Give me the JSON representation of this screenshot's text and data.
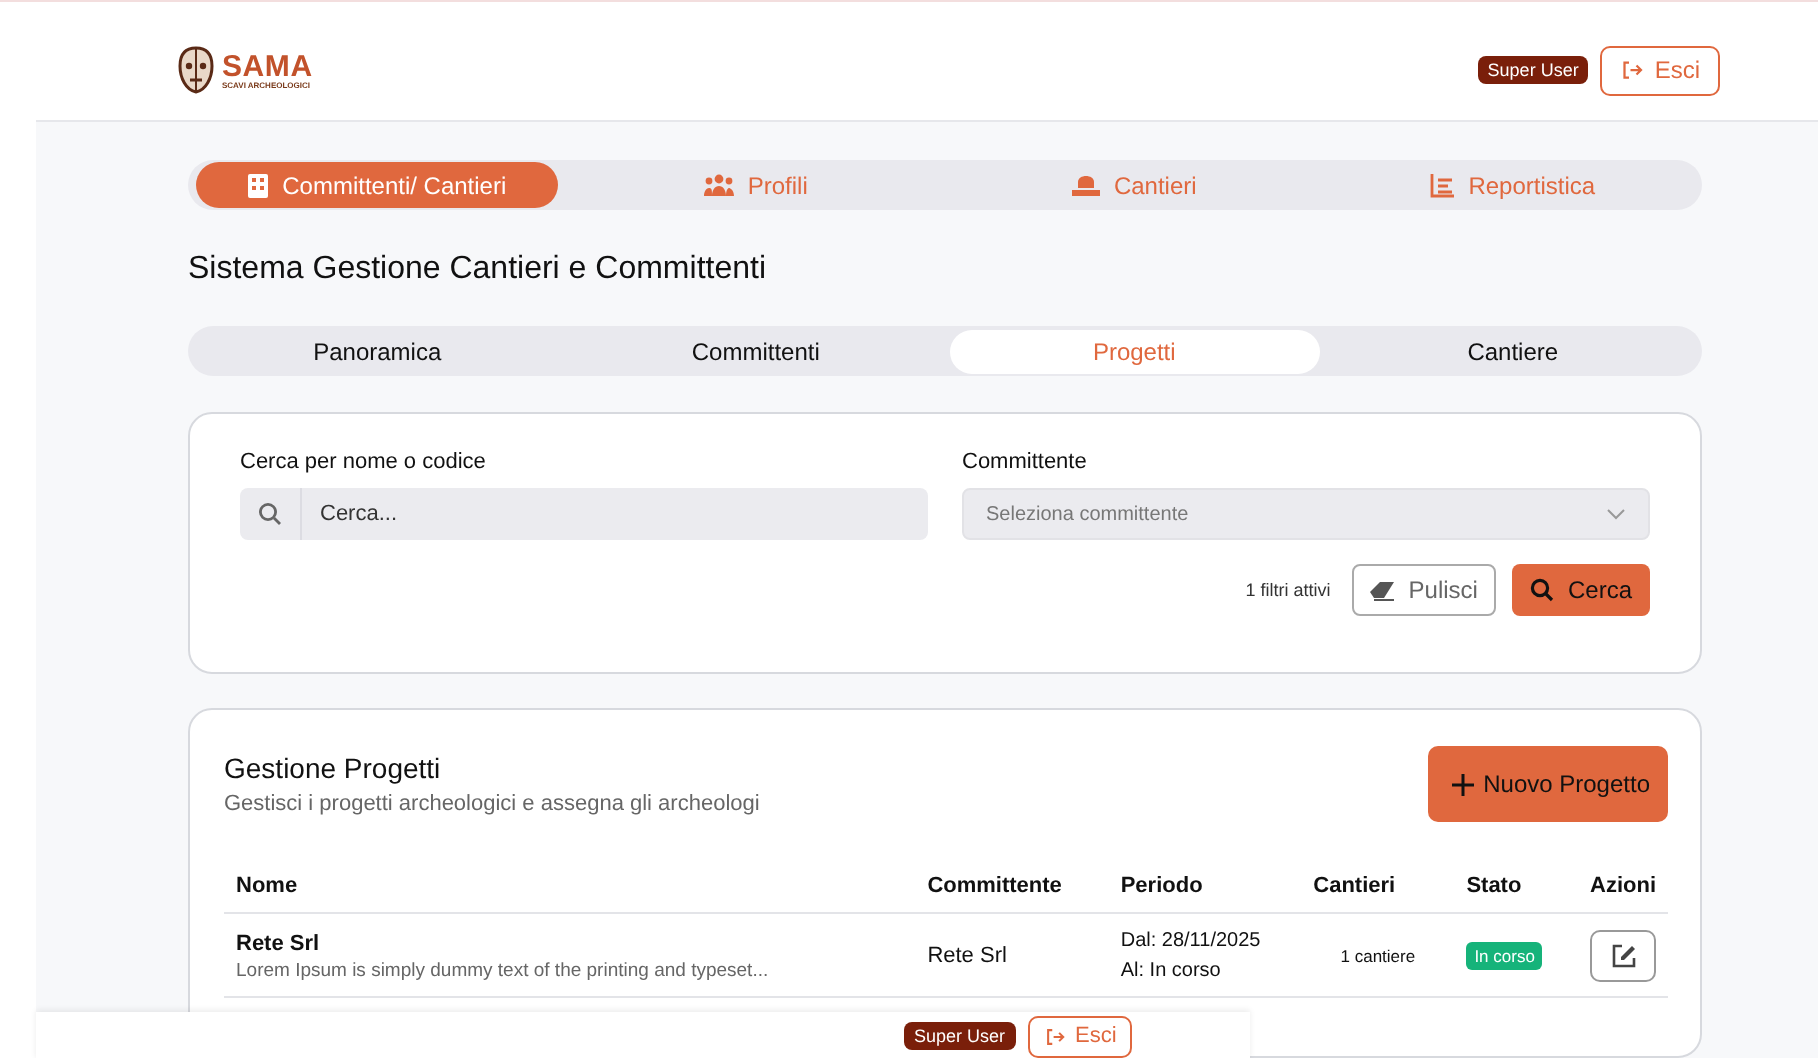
{
  "header": {
    "logo_title": "SAMA",
    "logo_subtitle": "SCAVI ARCHEOLOGICI",
    "role_badge": "Super User",
    "logout_button": "Esci"
  },
  "main_nav": [
    {
      "label": "Committenti/ Cantieri",
      "selected": true
    },
    {
      "label": "Profili",
      "selected": false
    },
    {
      "label": "Cantieri",
      "selected": false
    },
    {
      "label": "Reportistica",
      "selected": false
    }
  ],
  "page_title": "Sistema Gestione Cantieri e Committenti",
  "sub_tabs": [
    {
      "label": "Panoramica",
      "selected": false
    },
    {
      "label": "Committenti",
      "selected": false
    },
    {
      "label": "Progetti",
      "selected": true
    },
    {
      "label": "Cantiere",
      "selected": false
    }
  ],
  "filters": {
    "search_label": "Cerca per nome o codice",
    "search_placeholder": "Cerca...",
    "client_label": "Committente",
    "client_placeholder": "Seleziona committente",
    "active_count": "1 filtri attivi",
    "clear_button": "Pulisci",
    "search_button": "Cerca"
  },
  "projects": {
    "title": "Gestione Progetti",
    "subtitle": "Gestisci i progetti archeologici e assegna gli archeologi",
    "new_button": "Nuovo Progetto",
    "columns": [
      "Nome",
      "Committente",
      "Periodo",
      "Cantieri",
      "Stato",
      "Azioni"
    ],
    "rows": [
      {
        "name": "Rete Srl",
        "description": "Lorem Ipsum is simply dummy text of the printing and typeset...",
        "client": "Rete Srl",
        "from": "Dal: 28/11/2025",
        "to": "Al: In corso",
        "sites": "1 cantiere",
        "status": "In corso",
        "color": "#16b37a"
      }
    ]
  },
  "overlay_header": {
    "role_badge": "Super User",
    "logout_button": "Esci"
  }
}
